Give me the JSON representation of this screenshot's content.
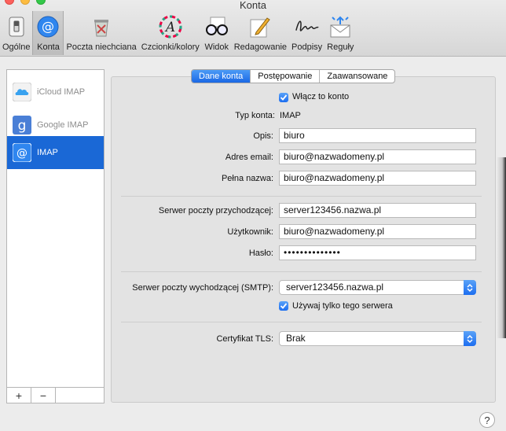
{
  "window": {
    "title": "Konta"
  },
  "toolbar": {
    "items": [
      {
        "label": "Ogólne",
        "icon": "switch-icon"
      },
      {
        "label": "Konta",
        "icon": "at-icon"
      },
      {
        "label": "Poczta niechciana",
        "icon": "junk-trash-icon"
      },
      {
        "label": "Czcionki/kolory",
        "icon": "font-color-icon"
      },
      {
        "label": "Widok",
        "icon": "glasses-icon"
      },
      {
        "label": "Redagowanie",
        "icon": "compose-pencil-icon"
      },
      {
        "label": "Podpisy",
        "icon": "signature-icon"
      },
      {
        "label": "Reguły",
        "icon": "rules-envelope-icon"
      }
    ]
  },
  "sidebar": {
    "accounts": [
      {
        "label": "iCloud IMAP",
        "icon": "icloud-icon"
      },
      {
        "label": "Google IMAP",
        "icon": "google-icon"
      },
      {
        "label": "IMAP",
        "icon": "at-icon"
      }
    ],
    "add_label": "+",
    "remove_label": "−"
  },
  "tabs": [
    "Dane konta",
    "Postępowanie",
    "Zaawansowane"
  ],
  "form": {
    "enable_label": "Włącz to konto",
    "type_label": "Typ konta:",
    "type_value": "IMAP",
    "description_label": "Opis:",
    "description_value": "biuro",
    "email_label": "Adres email:",
    "email_value": "biuro@nazwadomeny.pl",
    "fullname_label": "Pełna nazwa:",
    "fullname_value": "biuro@nazwadomeny.pl",
    "incoming_label": "Serwer poczty przychodzącej:",
    "incoming_value": "server123456.nazwa.pl",
    "user_label": "Użytkownik:",
    "user_value": "biuro@nazwadomeny.pl",
    "password_label": "Hasło:",
    "password_value": "••••••••••••••",
    "smtp_label": "Serwer poczty wychodzącej (SMTP):",
    "smtp_value": "server123456.nazwa.pl",
    "only_server_label": "Używaj tylko tego serwera",
    "tls_label": "Certyfikat TLS:",
    "tls_value": "Brak"
  },
  "help_label": "?",
  "colors": {
    "accent": "#1a68d6",
    "selected_row": "#1a68d6"
  }
}
